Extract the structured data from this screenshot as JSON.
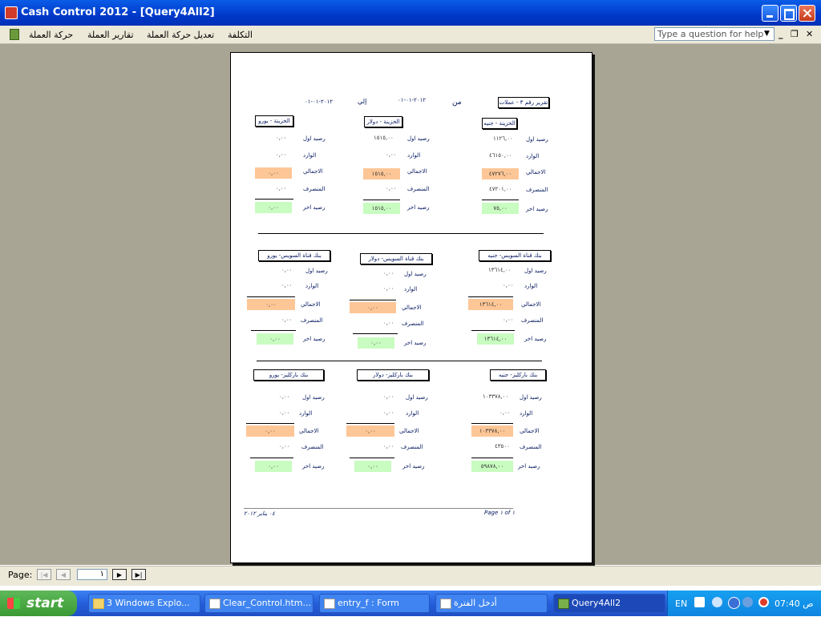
{
  "window": {
    "title": "Cash Control 2012 - [Query4All2]"
  },
  "menu": {
    "items": [
      "التكلفة",
      "تعديل حركة العملة",
      "تقارير العملة",
      "حركة العملة"
    ],
    "help_placeholder": "Type a question for help"
  },
  "report": {
    "title_box": "تقرير رقم ٣ - عملات",
    "from_label": "من",
    "from_date": "٢٠١٢-٠١-٠١",
    "to_label": "إلي",
    "to_date": "٢٠١٢-٠١-٠١",
    "labels": {
      "opening": "رصيد اول",
      "incoming": "الوارد",
      "total": "الاجمالي",
      "spent": "المنصرف",
      "closing": "رصيد اخر"
    },
    "sections": [
      {
        "columns": [
          {
            "header": "الخزينة - جنيه",
            "opening": "١١٢٦,٠٠",
            "incoming": "٤٦١٥٠,٠٠",
            "total": "٤٧٢٧٦,٠٠",
            "spent": "٤٧٢٠١,٠٠",
            "closing": "٧٥,٠٠"
          },
          {
            "header": "الخزينة - دولار",
            "opening": "١٥١٥,٠٠",
            "incoming": "٠,٠٠",
            "total": "١٥١٥,٠٠",
            "spent": "٠,٠٠",
            "closing": "١٥١٥,٠٠"
          },
          {
            "header": "الخزينة - يورو",
            "opening": "٠,٠٠",
            "incoming": "٠,٠٠",
            "total": "٠,٠٠",
            "spent": "٠,٠٠",
            "closing": "٠,٠٠"
          }
        ]
      },
      {
        "columns": [
          {
            "header": "بنك قناة السويس- جنيه",
            "opening": "١٣٦١٤,٠٠",
            "incoming": "٠,٠٠",
            "total": "١٣٦١٤,٠٠",
            "spent": "٠,٠٠",
            "closing": "١٣٦١٤,٠٠"
          },
          {
            "header": "بنك قناة السويس- دولار",
            "opening": "٠,٠٠",
            "incoming": "٠,٠٠",
            "total": "٠,٠٠",
            "spent": "٠,٠٠",
            "closing": "٠,٠٠"
          },
          {
            "header": "بنك قناة السويس- يورو",
            "opening": "٠,٠٠",
            "incoming": "٠,٠٠",
            "total": "٠,٠٠",
            "spent": "٠,٠٠",
            "closing": "٠,٠٠"
          }
        ]
      },
      {
        "columns": [
          {
            "header": "بنك باركليز- جنيه",
            "opening": "١٠٣٣٧٨,٠٠",
            "incoming": "٠,٠٠",
            "total": "١٠٣٣٧٨,٠٠",
            "spent": "٤٣٥٠٠",
            "closing": "٥٩٨٧٨,٠٠"
          },
          {
            "header": "بنك باركليز- دولار",
            "opening": "٠,٠٠",
            "incoming": "٠,٠٠",
            "total": "٠,٠٠",
            "spent": "٠,٠٠",
            "closing": "٠,٠٠"
          },
          {
            "header": "بنك باركليز- يورو",
            "opening": "٠,٠٠",
            "incoming": "٠,٠٠",
            "total": "٠,٠٠",
            "spent": "٠,٠٠",
            "closing": "٠,٠٠"
          }
        ]
      }
    ],
    "footer_left": "٠٤ يناير ٢٠١٢",
    "footer_right": "Page ١ of ١"
  },
  "statusbar": {
    "page_label": "Page:",
    "page_value": "١"
  },
  "taskbar": {
    "start": "start",
    "tasks": [
      "3 Windows Explo...",
      "Clear_Control.htm...",
      "entry_f : Form",
      "أدخل الفترة",
      "Query4All2"
    ],
    "lang": "EN",
    "clock": "07:40 ص"
  },
  "colors": {
    "total_fill": "#fdc696",
    "closing_fill": "#c8fcc0",
    "title_bar": "#0a5de8"
  }
}
